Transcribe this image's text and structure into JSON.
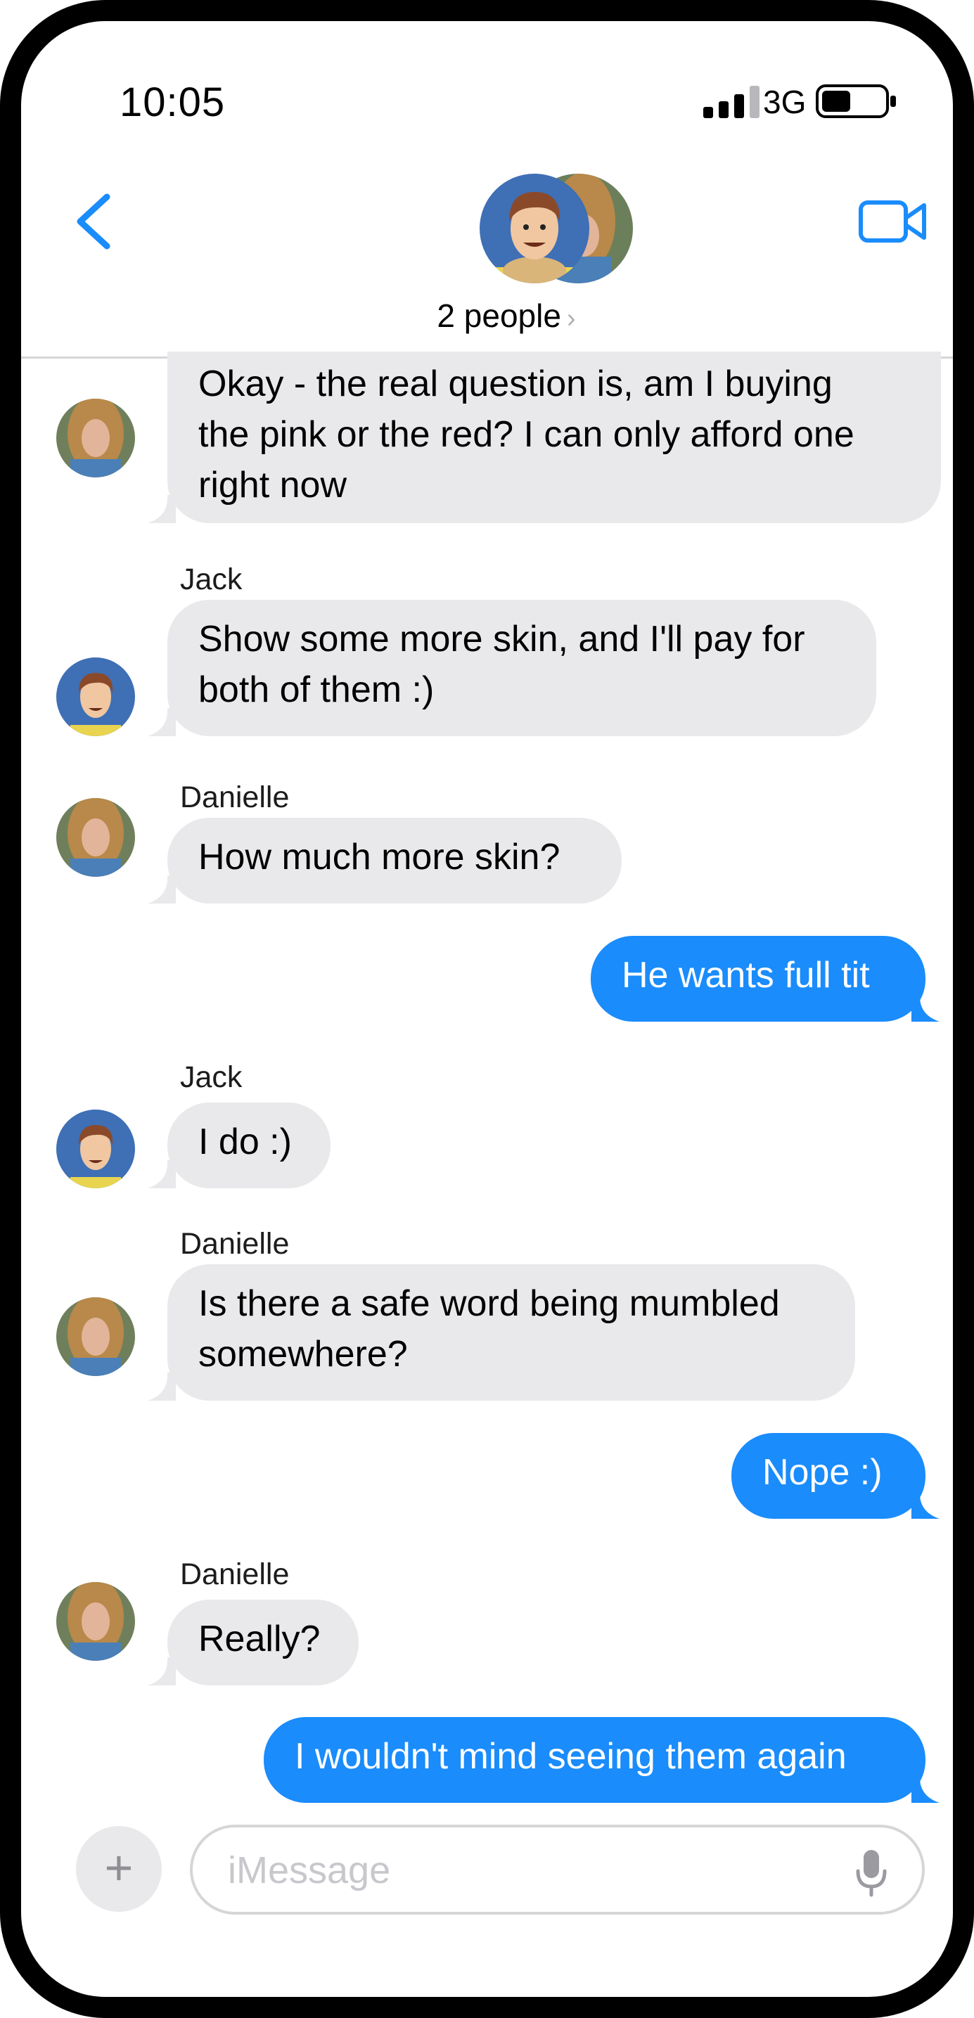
{
  "status_bar": {
    "time": "10:05",
    "network": "3G"
  },
  "header": {
    "people_label": "2 people",
    "chevron": "›"
  },
  "messages": [
    {
      "direction": "received",
      "sender": "",
      "text_lines": [
        "Okay - the real question is, am I buying",
        "the pink or the red?  I can only afford one",
        "right now"
      ]
    },
    {
      "direction": "received",
      "sender": "Jack",
      "text_lines": [
        "Show some more skin, and I'll pay for",
        "both of them :)"
      ]
    },
    {
      "direction": "received",
      "sender": "Danielle",
      "text_lines": [
        "How much more skin?"
      ]
    },
    {
      "direction": "sent",
      "text_lines": [
        "He wants full tit"
      ]
    },
    {
      "direction": "received",
      "sender": "Jack",
      "text_lines": [
        "I do :)"
      ]
    },
    {
      "direction": "received",
      "sender": "Danielle",
      "text_lines": [
        "Is there a safe word being mumbled",
        "somewhere?"
      ]
    },
    {
      "direction": "sent",
      "text_lines": [
        "Nope :)"
      ]
    },
    {
      "direction": "received",
      "sender": "Danielle",
      "text_lines": [
        "Really?"
      ]
    },
    {
      "direction": "sent",
      "text_lines": [
        "I wouldn't mind seeing them again"
      ]
    }
  ],
  "input": {
    "placeholder": "iMessage",
    "plus_symbol": "+"
  },
  "icons": {
    "back": "chevron-left-icon",
    "video": "video-camera-icon",
    "mic": "microphone-icon",
    "add": "plus-icon"
  },
  "colors": {
    "accent": "#1a8cfb",
    "received_bubble": "#e9e9eb",
    "sent_bubble": "#1a8cfb"
  }
}
